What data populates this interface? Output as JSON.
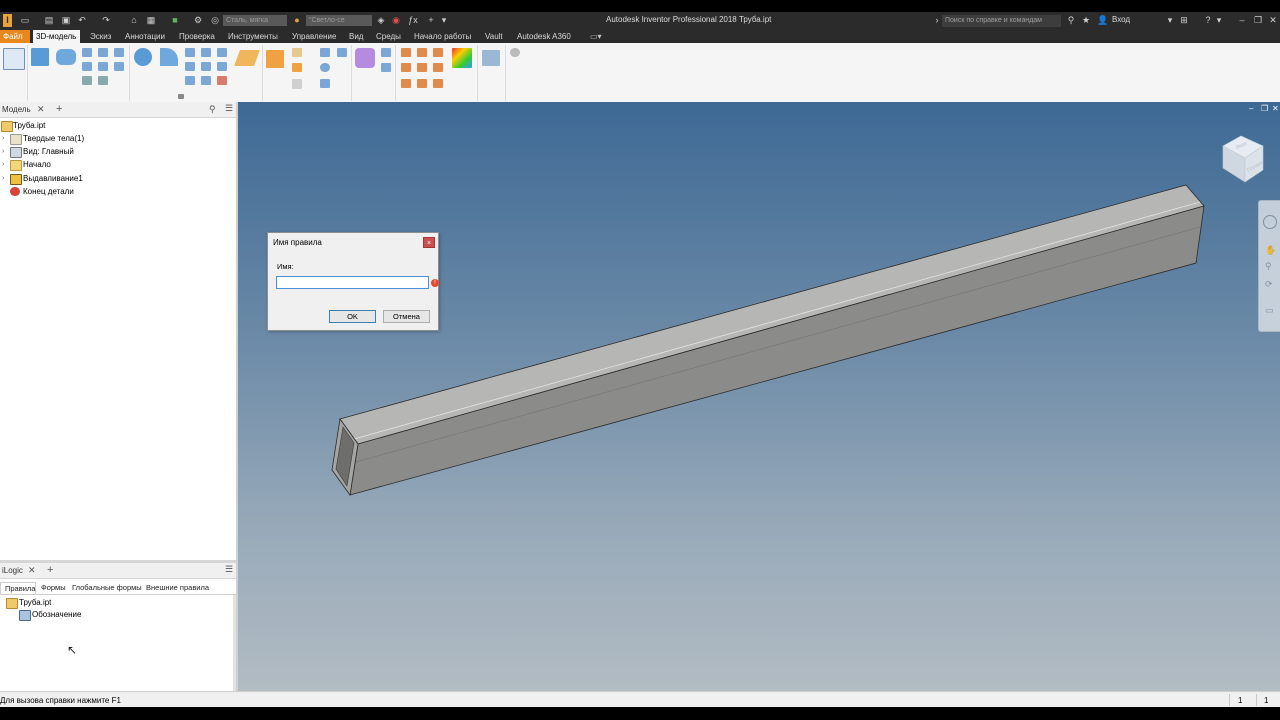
{
  "window": {
    "title": "Autodesk Inventor Professional 2018   Труба.ipt"
  },
  "quick_access": {
    "material": "Сталь, мягка",
    "appearance": "\"Светло-се",
    "search_placeholder": "Поиск по справке и командам",
    "sign_in": "Вход"
  },
  "menu": {
    "file": "Файл",
    "tabs": [
      "3D-модель",
      "Эскиз",
      "Аннотации",
      "Проверка",
      "Инструменты",
      "Управление",
      "Вид",
      "Среды",
      "Начало работы",
      "Vault",
      "Autodesk A360"
    ]
  },
  "browser": {
    "tab_label": "Модель",
    "tree": [
      {
        "label": "Труба.ipt"
      },
      {
        "label": "Твердые тела(1)"
      },
      {
        "label": "Вид: Главный"
      },
      {
        "label": "Начало"
      },
      {
        "label": "Выдавливание1"
      },
      {
        "label": "Конец детали"
      }
    ]
  },
  "ilogic": {
    "tab_label": "iLogic",
    "subtabs": [
      "Правила",
      "Формы",
      "Глобальные формы",
      "Внешние правила"
    ],
    "tree": [
      {
        "label": "Труба.ipt"
      },
      {
        "label": "Обозначение"
      }
    ]
  },
  "dialog": {
    "title": "Имя правила",
    "close": "×",
    "name_label": "Имя:",
    "name_value": "",
    "error_glyph": "!",
    "ok_label": "OK",
    "cancel_label": "Отмена"
  },
  "viewcube": {
    "top_label": "Верх",
    "front_label": "Справа"
  },
  "status": {
    "hint": "Для вызова справки нажмите F1",
    "count_a": "1",
    "count_b": "1"
  }
}
